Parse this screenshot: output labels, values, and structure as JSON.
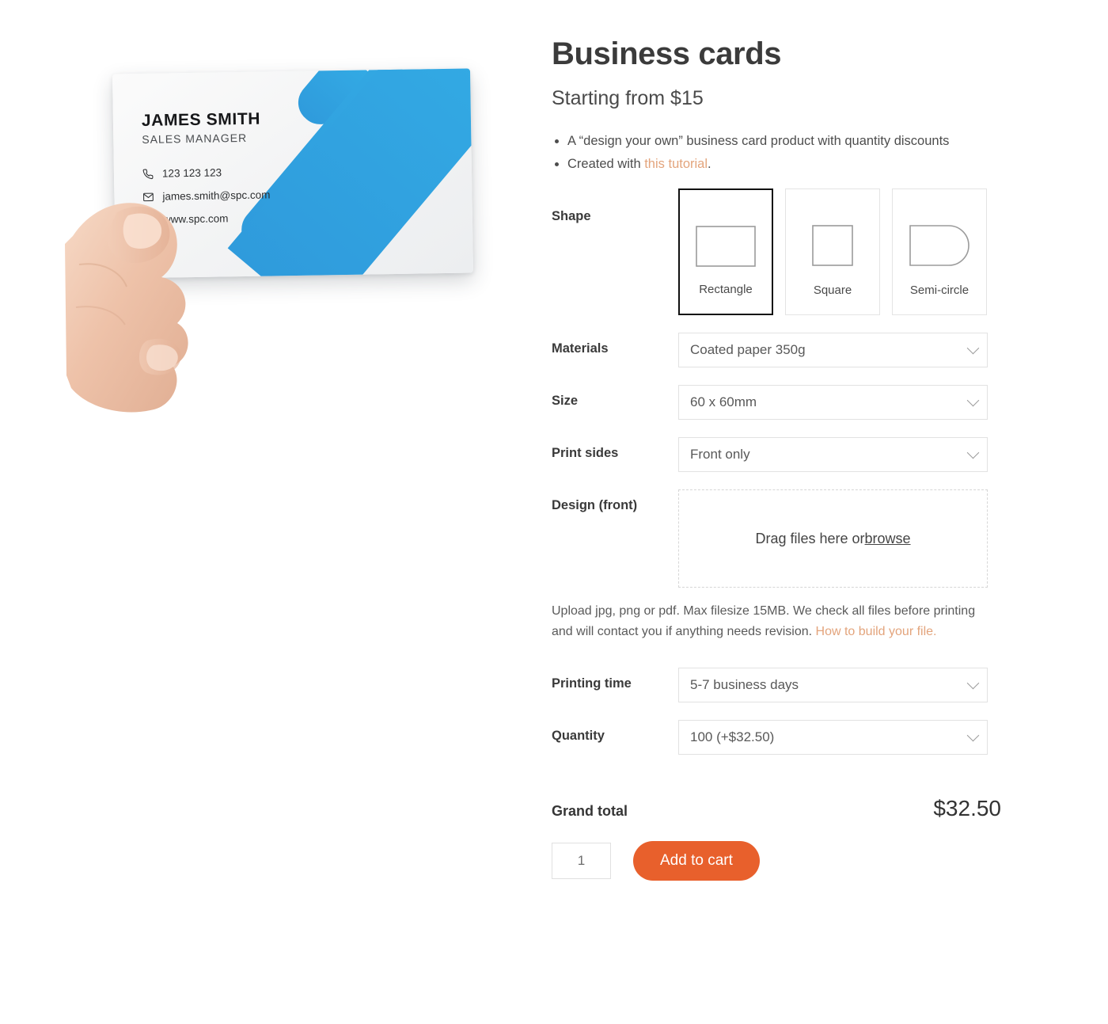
{
  "product_photo": {
    "alt": "Hand holding a business card",
    "card": {
      "name": "JAMES SMITH",
      "role": "SALES MANAGER",
      "phone": "123 123 123",
      "email": "james.smith@spc.com",
      "website": "www.spc.com"
    },
    "accent_blue": "#33aae4"
  },
  "header": {
    "title": "Business cards",
    "subtitle": "Starting from $15"
  },
  "bullets": [
    {
      "before": "A “design your own” business card product with quantity discounts",
      "link": "",
      "after": ""
    },
    {
      "before": "Created with ",
      "link": "this tutorial",
      "after": "."
    }
  ],
  "shape": {
    "label": "Shape",
    "options": [
      {
        "name": "Rectangle",
        "icon": "rectangle-icon",
        "selected": true
      },
      {
        "name": "Square",
        "icon": "square-icon",
        "selected": false
      },
      {
        "name": "Semi-circle",
        "icon": "semi-circle-icon",
        "selected": false
      }
    ]
  },
  "fields": {
    "materials": {
      "label": "Materials",
      "value": "Coated paper 350g"
    },
    "size": {
      "label": "Size",
      "value": "60 x 60mm"
    },
    "print_sides": {
      "label": "Print sides",
      "value": "Front only"
    },
    "design_front": {
      "label": "Design (front)",
      "drop_text": "Drag files here or ",
      "browse_label": "browse"
    },
    "printing_time": {
      "label": "Printing time",
      "value": "5-7 business days"
    },
    "quantity": {
      "label": "Quantity",
      "value": "100 (+$32.50)"
    }
  },
  "helper": {
    "text": "Upload jpg, png or pdf. Max filesize 15MB. We check all files before printing and will contact you if anything needs revision. ",
    "link": "How to build your file."
  },
  "totals": {
    "label": "Grand total",
    "value": "$32.50"
  },
  "cart": {
    "quantity_value": "1",
    "button_label": "Add to cart",
    "button_color": "#e8602c"
  },
  "link_color": "#e3a47c"
}
